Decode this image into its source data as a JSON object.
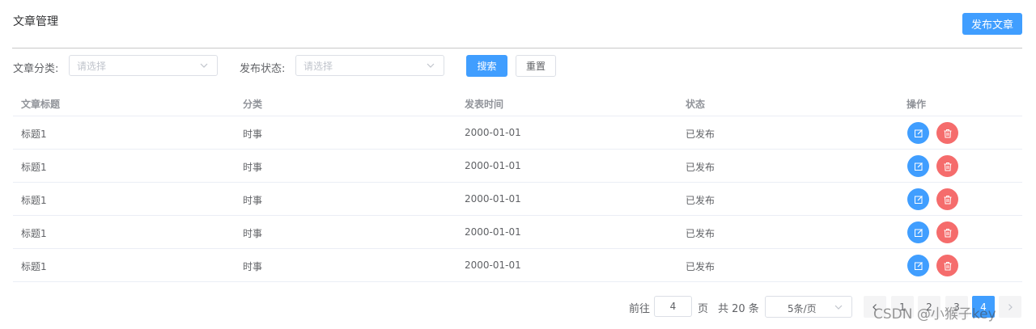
{
  "page": {
    "title": "文章管理",
    "publish_button": "发布文章"
  },
  "filters": {
    "category_label": "文章分类:",
    "category_placeholder": "请选择",
    "status_label": "发布状态:",
    "status_placeholder": "请选择",
    "search_button": "搜索",
    "reset_button": "重置"
  },
  "table": {
    "headers": [
      "文章标题",
      "分类",
      "发表时间",
      "状态",
      "操作"
    ],
    "rows": [
      {
        "title": "标题1",
        "category": "时事",
        "date": "2000-01-01",
        "status": "已发布"
      },
      {
        "title": "标题1",
        "category": "时事",
        "date": "2000-01-01",
        "status": "已发布"
      },
      {
        "title": "标题1",
        "category": "时事",
        "date": "2000-01-01",
        "status": "已发布"
      },
      {
        "title": "标题1",
        "category": "时事",
        "date": "2000-01-01",
        "status": "已发布"
      },
      {
        "title": "标题1",
        "category": "时事",
        "date": "2000-01-01",
        "status": "已发布"
      }
    ],
    "edit_icon": "edit-icon",
    "delete_icon": "trash-icon"
  },
  "pagination": {
    "goto_label": "前往",
    "goto_value": "4",
    "page_unit": "页",
    "total_text": "共 20 条",
    "page_size": "5条/页",
    "pages": [
      "1",
      "2",
      "3",
      "4"
    ],
    "current_page": "4"
  },
  "watermark": "CSDN @小猴子key",
  "colors": {
    "primary": "#409eff",
    "danger": "#f56c6c"
  }
}
